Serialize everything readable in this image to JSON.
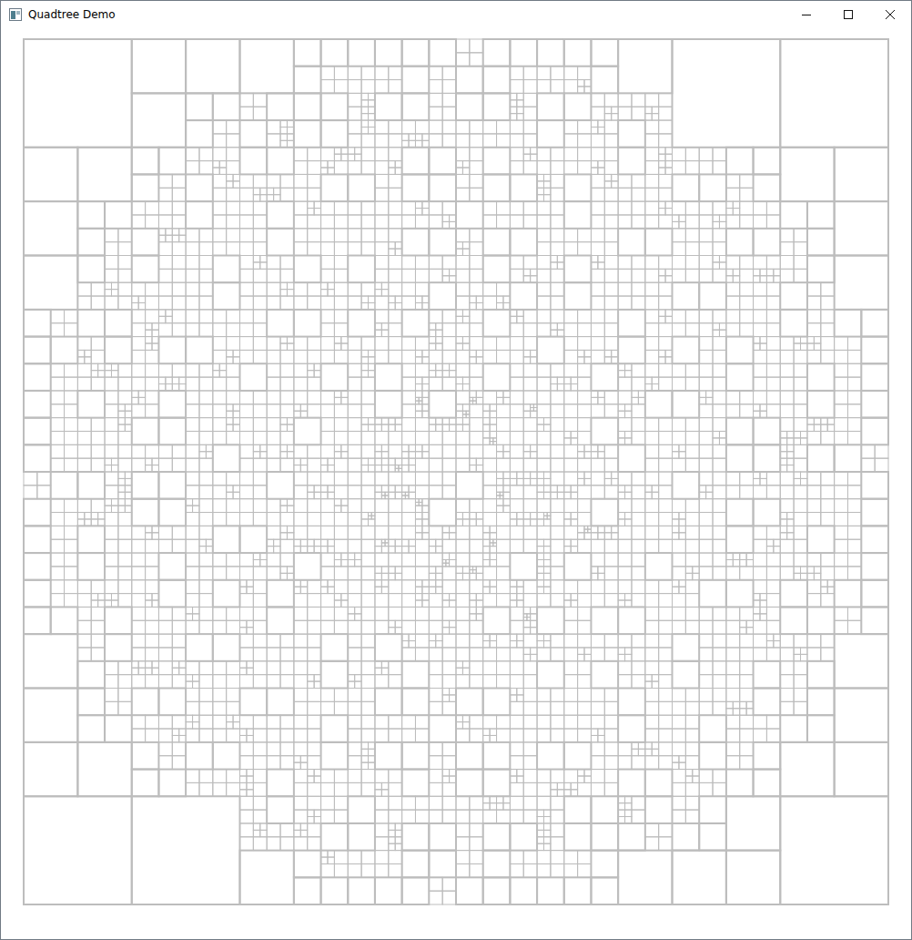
{
  "window": {
    "title": "Quadtree Demo"
  }
}
